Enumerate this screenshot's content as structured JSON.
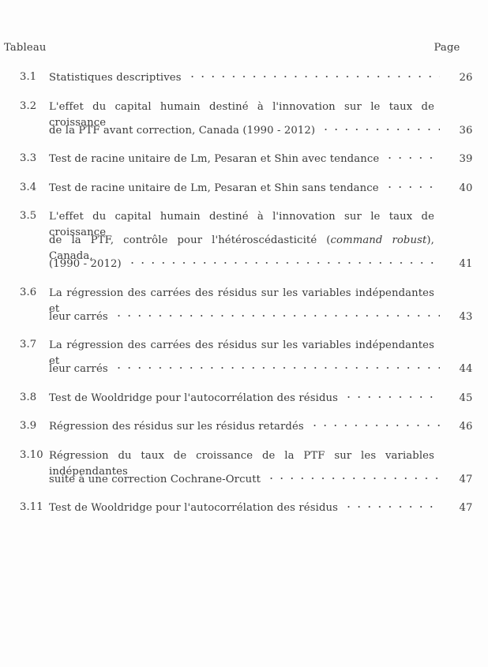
{
  "document": {
    "kind": "list-of-tables",
    "header": {
      "left_label": "Tableau",
      "right_label": "Page"
    },
    "text_color": "#3b3b3b",
    "background_color": "#fdfdfd"
  },
  "entries": [
    {
      "number": "3.1",
      "page": "26",
      "lines": [
        {
          "text": "Statistiques descriptives",
          "leaders": true,
          "page": "26",
          "justify": false
        }
      ]
    },
    {
      "number": "3.2",
      "page": "36",
      "lines": [
        {
          "text": "L'effet du capital humain destiné à l'innovation sur le taux de croissance",
          "leaders": false,
          "page": "",
          "justify": true
        },
        {
          "text": "de la PTF avant correction, Canada (1990 - 2012)",
          "leaders": true,
          "page": "36",
          "justify": false
        }
      ]
    },
    {
      "number": "3.3",
      "page": "39",
      "lines": [
        {
          "text": "Test de racine unitaire de Lm, Pesaran et Shin avec tendance",
          "leaders": true,
          "page": "39",
          "justify": false
        }
      ]
    },
    {
      "number": "3.4",
      "page": "40",
      "lines": [
        {
          "text": "Test de racine unitaire de Lm, Pesaran et Shin sans tendance",
          "leaders": true,
          "page": "40",
          "justify": false
        }
      ]
    },
    {
      "number": "3.5",
      "page": "41",
      "lines": [
        {
          "text": "L'effet du capital humain destiné à l'innovation sur le taux de croissance",
          "leaders": false,
          "page": "",
          "justify": true
        },
        {
          "text_html": "de la PTF, contrôle pour l'hétéroscédasticité (<i>command robust</i>), Canada,",
          "leaders": false,
          "page": "",
          "justify": true
        },
        {
          "text": "(1990 - 2012)",
          "leaders": true,
          "page": "41",
          "justify": false
        }
      ]
    },
    {
      "number": "3.6",
      "page": "43",
      "lines": [
        {
          "text": "La régression des carrées des résidus sur les variables indépendantes et",
          "leaders": false,
          "page": "",
          "justify": true
        },
        {
          "text": "leur carrés",
          "leaders": true,
          "page": "43",
          "justify": false
        }
      ]
    },
    {
      "number": "3.7",
      "page": "44",
      "lines": [
        {
          "text": "La régression des carrées des résidus sur les variables indépendantes et",
          "leaders": false,
          "page": "",
          "justify": true
        },
        {
          "text": "leur carrés",
          "leaders": true,
          "page": "44",
          "justify": false
        }
      ]
    },
    {
      "number": "3.8",
      "page": "45",
      "lines": [
        {
          "text": "Test de Wooldridge pour l'autocorrélation des résidus",
          "leaders": true,
          "page": "45",
          "justify": false
        }
      ]
    },
    {
      "number": "3.9",
      "page": "46",
      "lines": [
        {
          "text": "Régression des résidus sur les résidus retardés",
          "leaders": true,
          "page": "46",
          "justify": false
        }
      ]
    },
    {
      "number": "3.10",
      "page": "47",
      "lines": [
        {
          "text": "Régression du taux de croissance de la PTF sur les variables indépendantes",
          "leaders": false,
          "page": "",
          "justify": true
        },
        {
          "text": "suite à une correction Cochrane-Orcutt",
          "leaders": true,
          "page": "47",
          "justify": false
        }
      ]
    },
    {
      "number": "3.11",
      "page": "47",
      "lines": [
        {
          "text": "Test de Wooldridge pour l'autocorrélation des résidus",
          "leaders": true,
          "page": "47",
          "justify": false
        }
      ]
    }
  ]
}
